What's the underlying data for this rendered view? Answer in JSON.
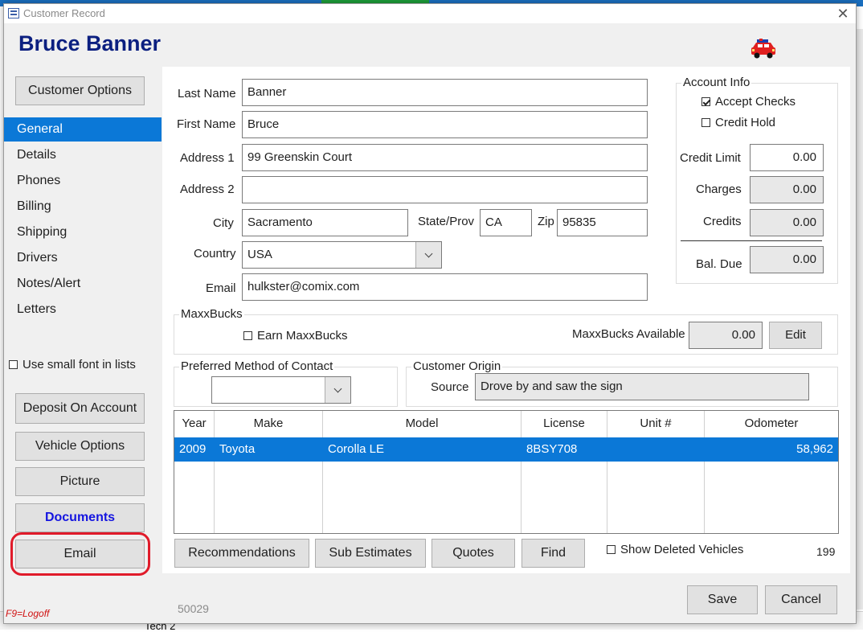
{
  "window": {
    "title": "Customer Record",
    "close_label": "✕"
  },
  "customer": {
    "name": "Bruce Banner"
  },
  "sidebar": {
    "customer_options": "Customer Options",
    "items": [
      {
        "label": "General",
        "active": true
      },
      {
        "label": "Details"
      },
      {
        "label": "Phones"
      },
      {
        "label": "Billing"
      },
      {
        "label": "Shipping"
      },
      {
        "label": "Drivers"
      },
      {
        "label": "Notes/Alert"
      },
      {
        "label": "Letters"
      }
    ],
    "small_font_label": "Use small font in lists",
    "buttons": {
      "deposit": "Deposit On Account",
      "vehicle_options": "Vehicle Options",
      "picture": "Picture",
      "documents": "Documents",
      "email": "Email"
    },
    "logoff_hint": "F9=Logoff",
    "record_id": "50029"
  },
  "form": {
    "last_name_label": "Last Name",
    "last_name": "Banner",
    "first_name_label": "First Name",
    "first_name": "Bruce",
    "address1_label": "Address 1",
    "address1": "99 Greenskin Court",
    "address2_label": "Address 2",
    "address2": "",
    "city_label": "City",
    "city": "Sacramento",
    "state_label": "State/Prov",
    "state": "CA",
    "zip_label": "Zip",
    "zip": "95835",
    "country_label": "Country",
    "country": "USA",
    "email_label": "Email",
    "email": "hulkster@comix.com"
  },
  "account_info": {
    "title": "Account Info",
    "accept_checks_label": "Accept Checks",
    "accept_checks": true,
    "credit_hold_label": "Credit Hold",
    "credit_hold": false,
    "credit_limit_label": "Credit Limit",
    "credit_limit": "0.00",
    "charges_label": "Charges",
    "charges": "0.00",
    "credits_label": "Credits",
    "credits": "0.00",
    "bal_due_label": "Bal. Due",
    "bal_due": "0.00"
  },
  "maxxbucks": {
    "title": "MaxxBucks",
    "earn_label": "Earn MaxxBucks",
    "earn": false,
    "available_label": "MaxxBucks Available",
    "available": "0.00",
    "edit_label": "Edit"
  },
  "contact": {
    "title": "Preferred Method of Contact",
    "value": ""
  },
  "origin": {
    "title": "Customer Origin",
    "source_label": "Source",
    "source": "Drove by and saw the sign"
  },
  "vehicles": {
    "columns": [
      "Year",
      "Make",
      "Model",
      "License",
      "Unit #",
      "Odometer"
    ],
    "rows": [
      {
        "year": "2009",
        "make": "Toyota",
        "model": "Corolla LE",
        "license": "8BSY708",
        "unit": "",
        "odometer": "58,962"
      }
    ]
  },
  "actions": {
    "recommendations": "Recommendations",
    "sub_estimates": "Sub Estimates",
    "quotes": "Quotes",
    "find": "Find",
    "show_deleted_label": "Show Deleted Vehicles",
    "count": "199"
  },
  "footer": {
    "save": "Save",
    "cancel": "Cancel"
  },
  "background": {
    "underlying_text": "Tech 2"
  }
}
